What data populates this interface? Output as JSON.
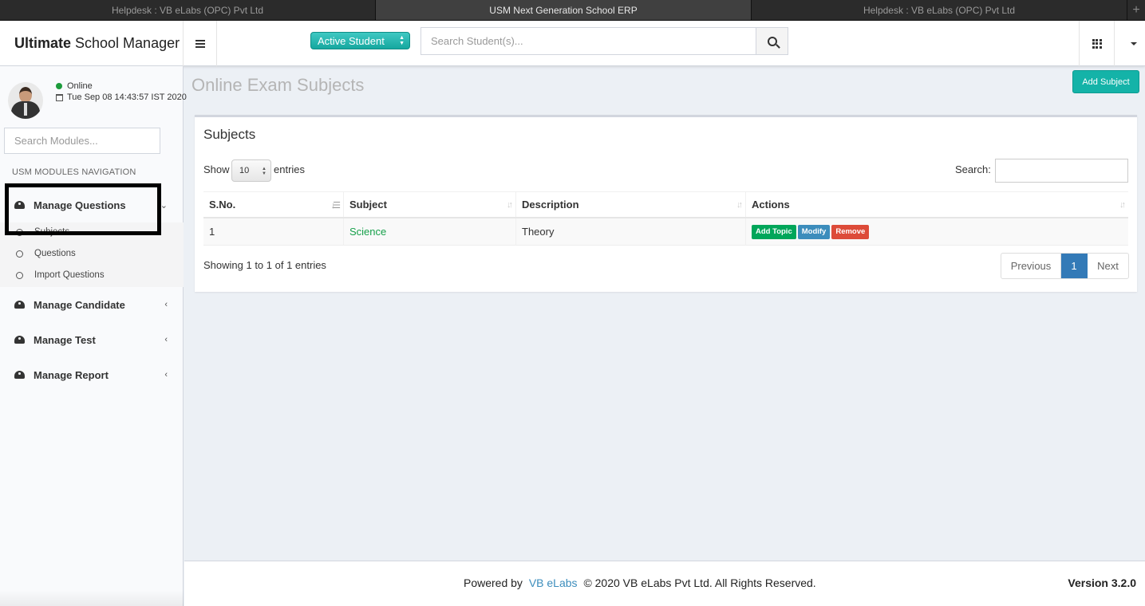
{
  "browser": {
    "tabs": [
      "Helpdesk : VB eLabs (OPC) Pvt Ltd",
      "USM Next Generation School ERP",
      "Helpdesk : VB eLabs (OPC) Pvt Ltd"
    ],
    "new_tab": "+"
  },
  "header": {
    "logo_bold": "Ultimate",
    "logo_rest": "School Manager",
    "student_filter": "Active Student",
    "search_placeholder": "Search Student(s)..."
  },
  "sidebar": {
    "user_status": "Online",
    "datetime": "Tue Sep 08 14:43:57 IST 2020",
    "module_search_placeholder": "Search Modules...",
    "nav_header": "USM MODULES NAVIGATION",
    "menu": [
      {
        "label": "Manage Questions",
        "expanded": true
      },
      {
        "label": "Manage Candidate",
        "expanded": false
      },
      {
        "label": "Manage Test",
        "expanded": false
      },
      {
        "label": "Manage Report",
        "expanded": false
      }
    ],
    "submenu": [
      "Subjects",
      "Questions",
      "Import Questions"
    ]
  },
  "page": {
    "title": "Online Exam Subjects",
    "add_button": "Add Subject"
  },
  "box": {
    "title": "Subjects",
    "show_label": "Show",
    "show_value": "10",
    "entries_label": "entries",
    "search_label": "Search:",
    "columns": [
      "S.No.",
      "Subject",
      "Description",
      "Actions"
    ],
    "rows": [
      {
        "sno": "1",
        "subject": "Science",
        "description": "Theory",
        "actions": [
          "Add Topic",
          "Modify",
          "Remove"
        ]
      }
    ],
    "info": "Showing 1 to 1 of 1 entries",
    "pagination": {
      "previous": "Previous",
      "current": "1",
      "next": "Next"
    }
  },
  "footer": {
    "powered_by": "Powered by",
    "brand": "VB eLabs",
    "copyright": "© 2020 VB eLabs Pvt Ltd. All Rights Reserved.",
    "version": "Version 3.2.0"
  },
  "colors": {
    "accent_teal": "#14b3a8",
    "add_topic": "#00a65a",
    "modify": "#3c8dbc",
    "remove": "#dd4b39",
    "pagination_active": "#337ab7"
  }
}
